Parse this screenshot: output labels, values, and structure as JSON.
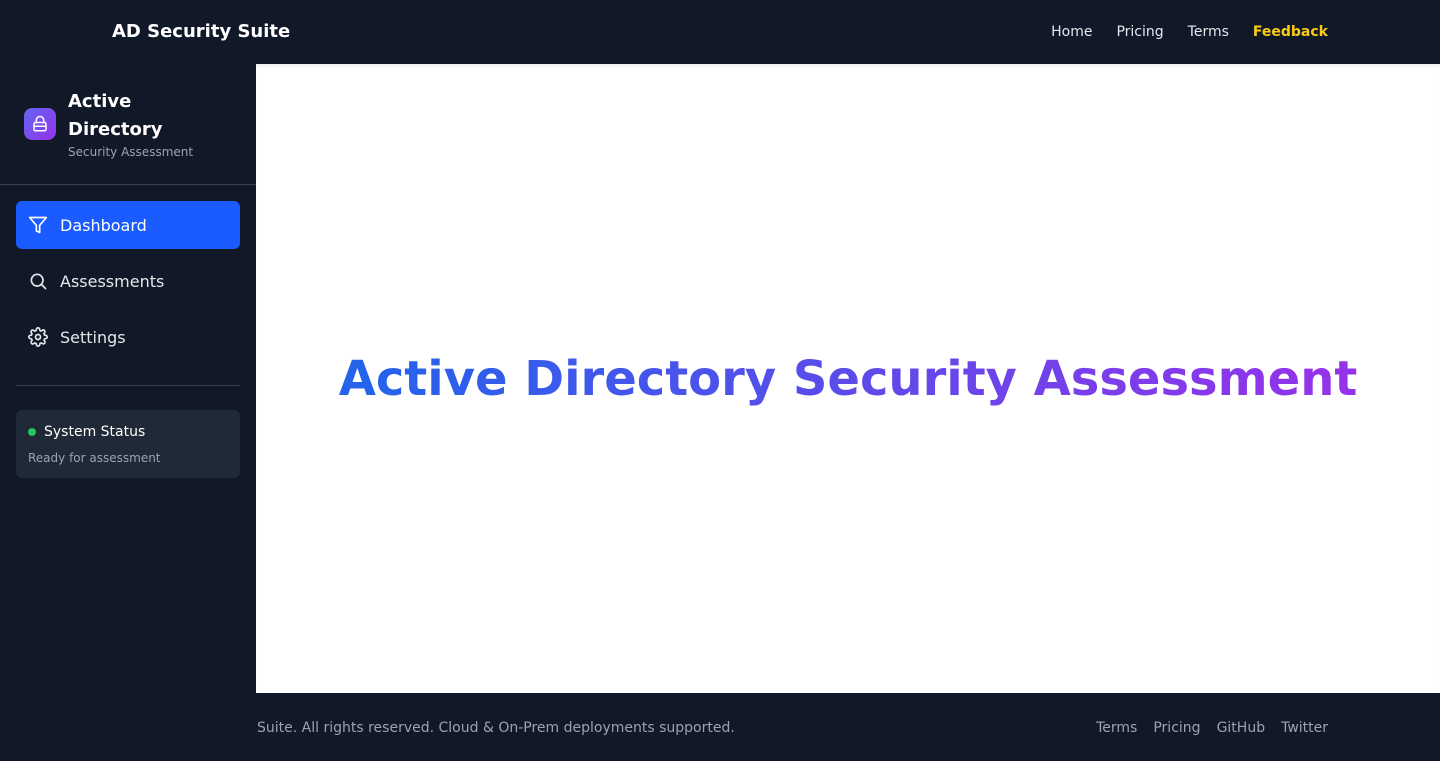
{
  "header": {
    "brand": "AD Security Suite",
    "nav": {
      "home": "Home",
      "pricing": "Pricing",
      "terms": "Terms",
      "feedback": "Feedback"
    }
  },
  "sidebar": {
    "title": "Active Directory",
    "subtitle": "Security Assessment",
    "logo_icon": "lock-icon",
    "items": [
      {
        "label": "Dashboard",
        "icon": "filter-icon",
        "active": true
      },
      {
        "label": "Assessments",
        "icon": "search-icon",
        "active": false
      },
      {
        "label": "Settings",
        "icon": "gear-icon",
        "active": false
      }
    ],
    "status": {
      "title": "System Status",
      "text": "Ready for assessment"
    }
  },
  "main": {
    "hero_title": "Active Directory Security Assessment"
  },
  "footer": {
    "copyright": "Suite. All rights reserved. Cloud & On-Prem deployments supported.",
    "links": {
      "terms": "Terms",
      "pricing": "Pricing",
      "github": "GitHub",
      "twitter": "Twitter"
    }
  },
  "colors": {
    "background": "#111827",
    "active_nav": "#1a5cff",
    "feedback": "#facc15",
    "status_ok": "#22c55e",
    "gradient_start": "#2563eb",
    "gradient_end": "#9333ea"
  }
}
